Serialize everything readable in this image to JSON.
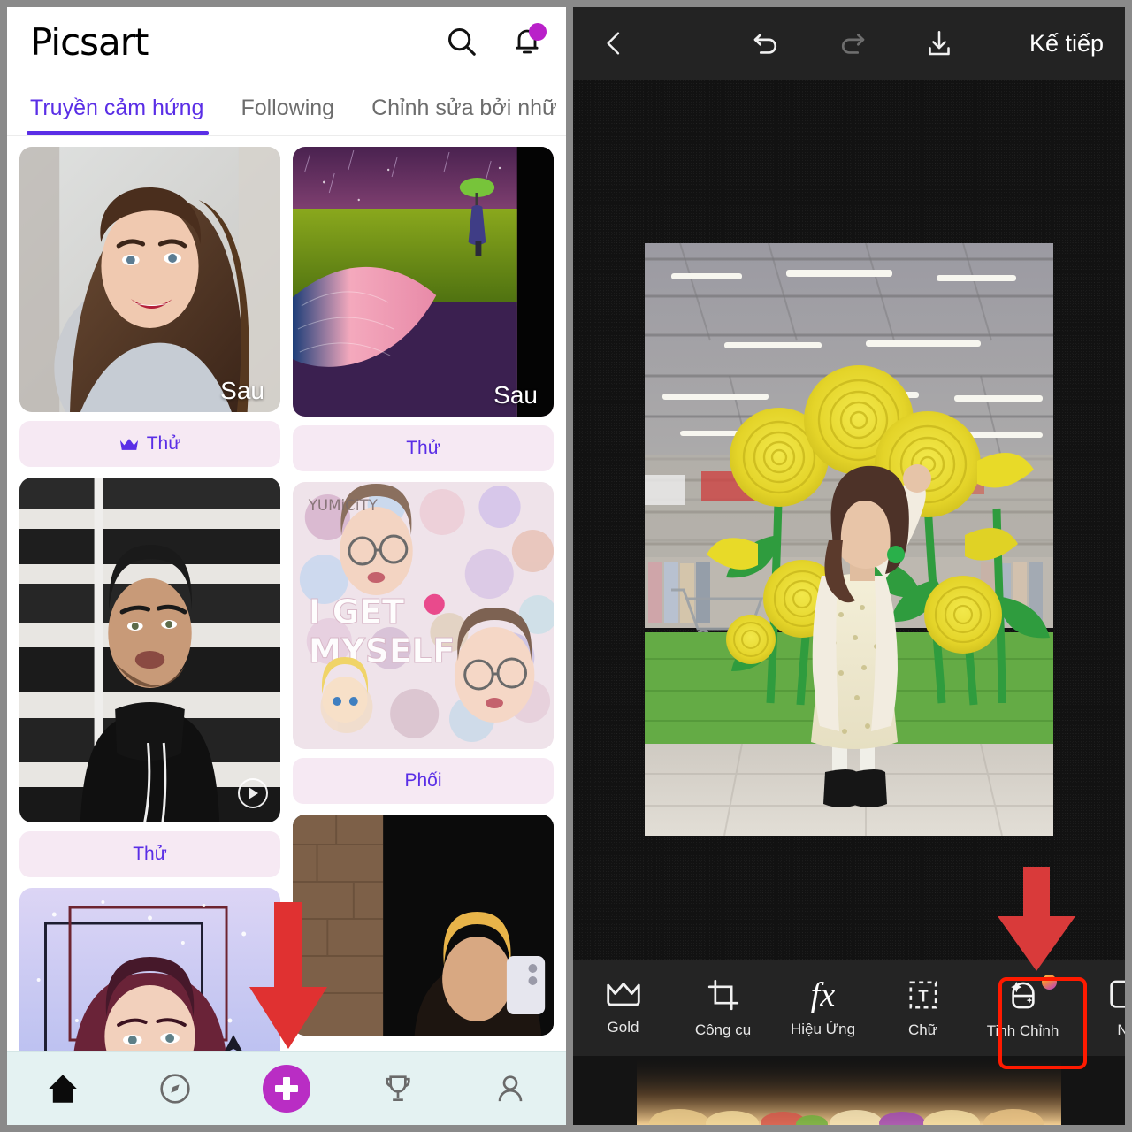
{
  "left_app": {
    "brand": "Picsart",
    "header_icons": [
      {
        "name": "search-icon",
        "label": "Search"
      },
      {
        "name": "bell-icon",
        "label": "Notifications"
      }
    ],
    "tabs": [
      {
        "label": "Truyền cảm hứng",
        "active": true
      },
      {
        "label": "Following",
        "active": false
      },
      {
        "label": "Chỉnh sửa bởi nhữ",
        "active": false
      }
    ],
    "cards": [
      {
        "overlay_label": "Sau",
        "cta": "Thử",
        "gold": true,
        "art": "portrait-woman-smiling"
      },
      {
        "overlay_label": "Sau",
        "cta": "Thử",
        "gold": false,
        "art": "surreal-umbrella-field"
      },
      {
        "overlay_label": "",
        "cta": "Thử",
        "gold": false,
        "art": "cartoon-man-leather-jacket",
        "has_replay": true
      },
      {
        "overlay_label": "",
        "cta": "Phối",
        "gold": false,
        "art": "sticker-collage-i-get-myself"
      },
      {
        "overlay_label": "",
        "cta": "",
        "gold": false,
        "art": "anime-girl-sparkle-frame"
      },
      {
        "overlay_label": "",
        "cta": "",
        "gold": false,
        "art": "mirror-selfie-blonde"
      }
    ],
    "bottom_nav": [
      {
        "name": "home-icon",
        "label": "Home",
        "active": true
      },
      {
        "name": "compass-icon",
        "label": "Discover",
        "active": false
      },
      {
        "name": "plus-icon",
        "label": "Create",
        "active": false,
        "highlighted": true
      },
      {
        "name": "trophy-icon",
        "label": "Challenges",
        "active": false
      },
      {
        "name": "profile-icon",
        "label": "Profile",
        "active": false
      }
    ]
  },
  "right_app": {
    "topbar": {
      "back_icon": "chevron-left-icon",
      "undo_icon": "undo-icon",
      "redo_icon": "redo-icon",
      "download_icon": "download-icon",
      "next_label": "Kế tiếp"
    },
    "canvas": {
      "photo": "woman-yellow-paper-roses-store"
    },
    "toolbar": [
      {
        "label": "Gold",
        "icon": "crown-icon",
        "highlighted": false,
        "badge": false
      },
      {
        "label": "Công cụ",
        "icon": "crop-icon",
        "highlighted": false,
        "badge": false
      },
      {
        "label": "Hiệu Ứng",
        "icon": "fx-icon",
        "highlighted": false,
        "badge": false
      },
      {
        "label": "Chữ",
        "icon": "text-icon",
        "highlighted": false,
        "badge": false
      },
      {
        "label": "Tinh Chỉnh",
        "icon": "retouch-icon",
        "highlighted": true,
        "badge": true
      },
      {
        "label": "N",
        "icon": "sticker-icon",
        "highlighted": false,
        "badge": false
      }
    ]
  },
  "colors": {
    "brand_purple": "#5a2ee6",
    "plus_magenta": "#b92dc4",
    "highlight_red": "#ff1a00",
    "cta_bg": "#f6e9f3",
    "nav_bg": "#e4f2f2",
    "editor_dark": "#242424"
  }
}
